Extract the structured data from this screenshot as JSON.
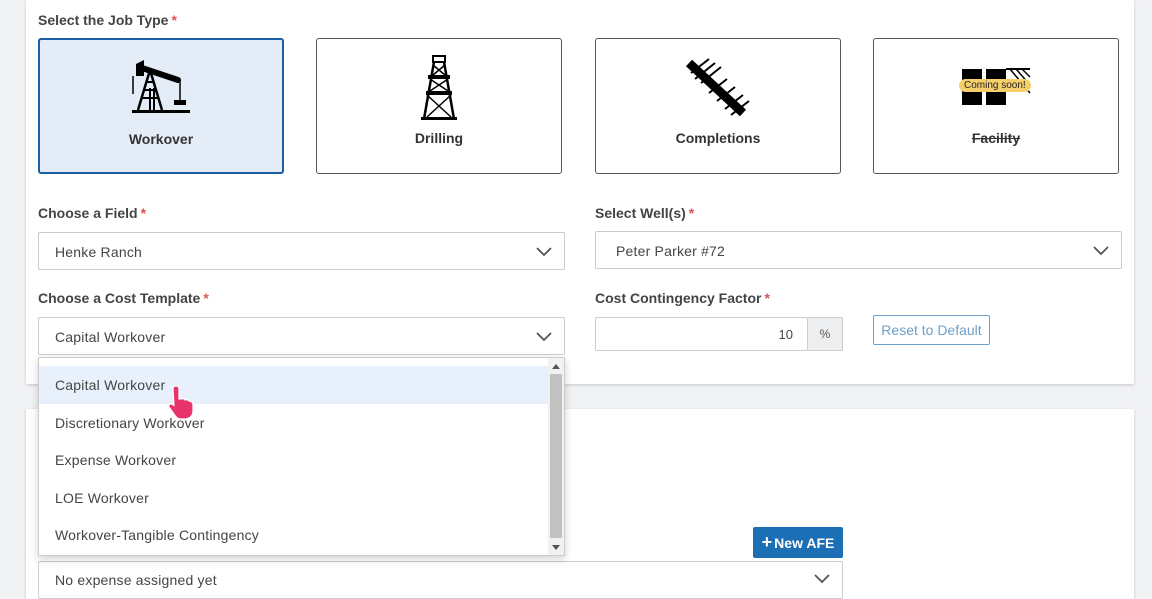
{
  "job_type": {
    "label": "Select the Job Type",
    "required_mark": "*",
    "options": [
      {
        "label": "Workover",
        "icon": "pumpjack-icon",
        "selected": true
      },
      {
        "label": "Drilling",
        "icon": "drilling-rig-icon",
        "selected": false
      },
      {
        "label": "Completions",
        "icon": "completions-pipe-icon",
        "selected": false
      },
      {
        "label": "Facility",
        "icon": "facility-icon",
        "selected": false,
        "badge": "Coming soon!"
      }
    ]
  },
  "field": {
    "label": "Choose a Field",
    "required_mark": "*",
    "value": "Henke Ranch"
  },
  "wells": {
    "label": "Select Well(s)",
    "required_mark": "*",
    "value": "Peter Parker #72"
  },
  "cost_template": {
    "label": "Choose a Cost Template",
    "required_mark": "*",
    "value": "Capital Workover",
    "options": [
      "Capital Workover",
      "Discretionary Workover",
      "Expense Workover",
      "LOE Workover",
      "Workover-Tangible Contingency"
    ],
    "highlighted_index": 0
  },
  "contingency": {
    "label": "Cost Contingency Factor",
    "required_mark": "*",
    "value": "10",
    "unit": "%",
    "reset_label": "Reset to Default"
  },
  "afe": {
    "new_button_label": "New AFE",
    "plus_glyph": "+",
    "expense_placeholder": "No expense assigned yet"
  },
  "colors": {
    "primary": "#1c6fb5",
    "selected_bg": "#e4edf7",
    "required": "#d9534f",
    "badge": "#f5d06a"
  }
}
